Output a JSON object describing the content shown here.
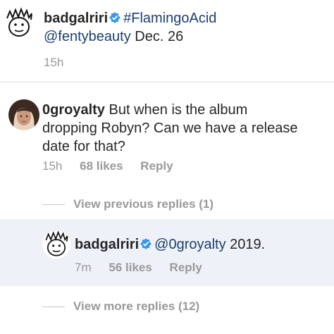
{
  "caption": {
    "username": "badgalriri",
    "hashtag": "#FlamingoAcid",
    "mention": "@fentybeauty",
    "date": "Dec. 26",
    "time": "15h"
  },
  "comment": {
    "username": "0groyalty",
    "line1": "But when is the album",
    "line2": "dropping Robyn? Can we have a release",
    "line3": "date for that?",
    "time": "15h",
    "likes": "68 likes",
    "reply_label": "Reply"
  },
  "view_previous": "View previous replies (1)",
  "reply": {
    "username": "badgalriri",
    "mention": "@0groyalty",
    "text": "2019.",
    "time": "7m",
    "likes": "56 likes",
    "reply_label": "Reply"
  },
  "view_more": "View more replies (12)",
  "colors": {
    "verified": "#3897f0",
    "link": "#1c3f6e",
    "meta": "#999999",
    "highlight": "#eef2f8"
  },
  "icons": {
    "verified": "verified-badge-icon",
    "rihanna_avatar": "doodle-face-avatar",
    "commenter_avatar": "profile-photo-avatar"
  }
}
